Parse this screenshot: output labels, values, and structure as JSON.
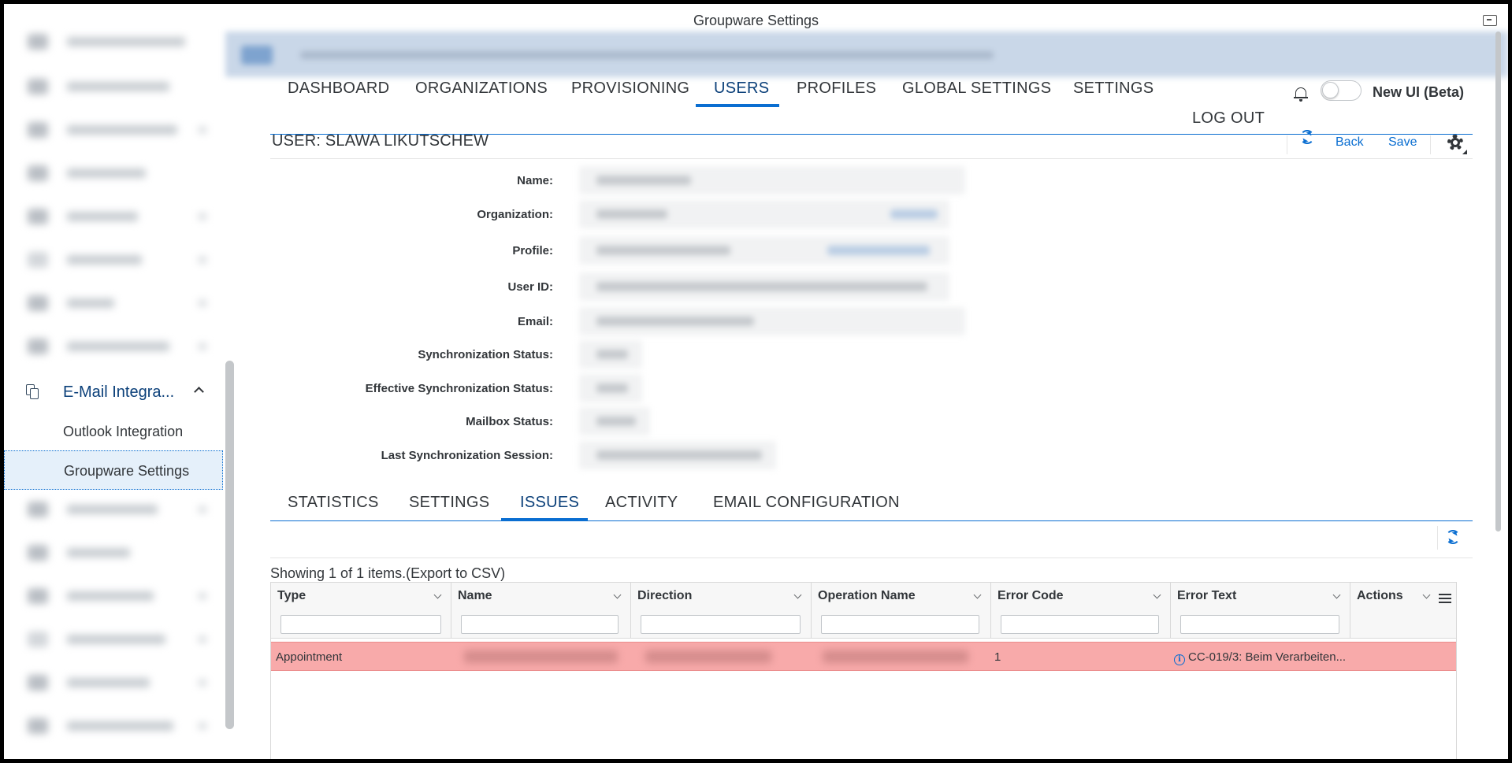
{
  "window": {
    "title": "Groupware Settings"
  },
  "sidebar": {
    "group_label": "E-Mail Integra...",
    "items": [
      {
        "label": "Outlook Integration"
      },
      {
        "label": "Groupware Settings"
      }
    ]
  },
  "topnav": {
    "tabs": [
      {
        "label": "DASHBOARD"
      },
      {
        "label": "ORGANIZATIONS"
      },
      {
        "label": "PROVISIONING"
      },
      {
        "label": "USERS"
      },
      {
        "label": "PROFILES"
      },
      {
        "label": "GLOBAL SETTINGS"
      },
      {
        "label": "SETTINGS"
      }
    ],
    "active_tab": "USERS",
    "logout_label": "LOG OUT",
    "toggle_label": "New UI (Beta)",
    "toggle_on": false
  },
  "user_header": {
    "title": "USER: SLAWA LIKUTSCHEW",
    "back_label": "Back",
    "save_label": "Save"
  },
  "form": {
    "fields": [
      {
        "label": "Name:"
      },
      {
        "label": "Organization:"
      },
      {
        "label": "Profile:"
      },
      {
        "label": "User ID:"
      },
      {
        "label": "Email:"
      },
      {
        "label": "Synchronization Status:"
      },
      {
        "label": "Effective Synchronization Status:"
      },
      {
        "label": "Mailbox Status:"
      },
      {
        "label": "Last Synchronization Session:"
      }
    ]
  },
  "subnav": {
    "tabs": [
      {
        "label": "STATISTICS"
      },
      {
        "label": "SETTINGS"
      },
      {
        "label": "ISSUES"
      },
      {
        "label": "ACTIVITY"
      },
      {
        "label": "EMAIL CONFIGURATION"
      }
    ],
    "active_tab": "ISSUES"
  },
  "issues": {
    "showing": "Showing 1 of 1 items.(Export to CSV)",
    "columns": [
      {
        "label": "Type"
      },
      {
        "label": "Name"
      },
      {
        "label": "Direction"
      },
      {
        "label": "Operation Name"
      },
      {
        "label": "Error Code"
      },
      {
        "label": "Error Text"
      },
      {
        "label": "Actions"
      }
    ],
    "rows": [
      {
        "type": "Appointment",
        "error_code": "1",
        "error_text": "CC-019/3: Beim Verarbeiten..."
      }
    ]
  },
  "colors": {
    "accent": "#0a6ed1",
    "error_row": "#f8aaaa",
    "selected_nav": "#e5f0fa"
  }
}
